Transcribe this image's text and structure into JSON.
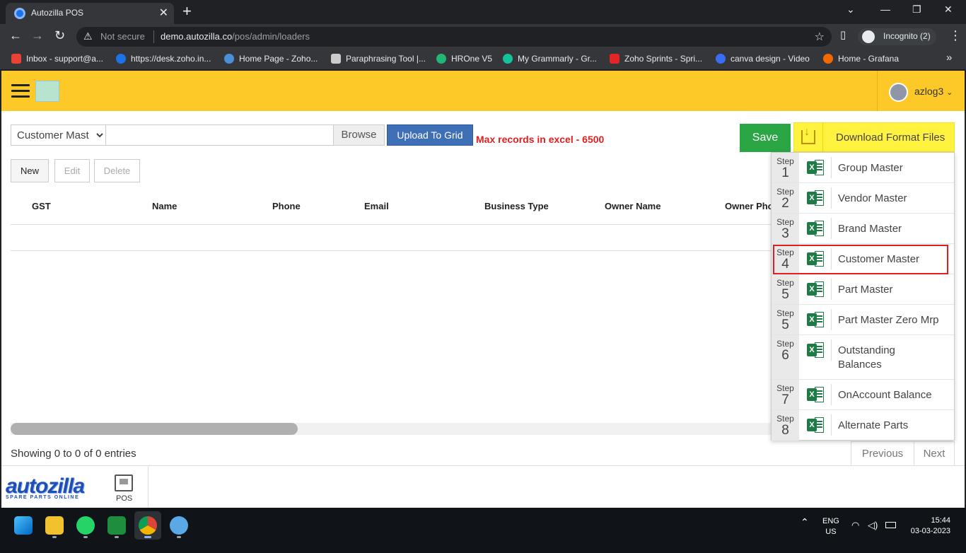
{
  "browser": {
    "tab_title": "Autozilla POS",
    "new_tab": "+",
    "not_secure": "Not secure",
    "url_host": "demo.autozilla.co",
    "url_path": "/pos/admin/loaders",
    "incognito": "Incognito (2)",
    "bookmarks": [
      {
        "label": "Inbox - support@a...",
        "color": "#ea4335"
      },
      {
        "label": "https://desk.zoho.in...",
        "color": "#1a73e8"
      },
      {
        "label": "Home Page - Zoho...",
        "color": "#4a90d9"
      },
      {
        "label": "Paraphrasing Tool |...",
        "color": "#cccccc"
      },
      {
        "label": "HROne V5",
        "color": "#22b573"
      },
      {
        "label": "My Grammarly - Gr...",
        "color": "#15c39a"
      },
      {
        "label": "Zoho Sprints - Spri...",
        "color": "#e42527"
      },
      {
        "label": "canva design - Video",
        "color": "#3b6cf5"
      },
      {
        "label": "Home - Grafana",
        "color": "#f46800"
      }
    ],
    "more": "»"
  },
  "header": {
    "username": "azlog3"
  },
  "toolbar": {
    "select_value": "Customer Mast",
    "browse": "Browse",
    "upload": "Upload To Grid",
    "max_records": "Max records in excel - 6500",
    "save": "Save",
    "download": "Download Format Files"
  },
  "actions": {
    "new": "New",
    "edit": "Edit",
    "delete": "Delete"
  },
  "table": {
    "columns": [
      "GST",
      "Name",
      "Phone",
      "Email",
      "Business Type",
      "Owner Name",
      "Owner Pho"
    ]
  },
  "footer": {
    "showing": "Showing 0 to 0 of 0 entries",
    "previous": "Previous",
    "next": "Next"
  },
  "bottom_nav": {
    "brand": "autozilla",
    "tagline": "SPARE PARTS ONLINE",
    "pos": "POS"
  },
  "dropdown": [
    {
      "step_label": "Step",
      "step": "1",
      "label": "Group Master"
    },
    {
      "step_label": "Step",
      "step": "2",
      "label": "Vendor Master"
    },
    {
      "step_label": "Step",
      "step": "3",
      "label": "Brand Master"
    },
    {
      "step_label": "Step",
      "step": "4",
      "label": "Customer Master",
      "highlighted": true
    },
    {
      "step_label": "Step",
      "step": "5",
      "label": "Part Master"
    },
    {
      "step_label": "Step",
      "step": "5",
      "label": "Part Master Zero Mrp"
    },
    {
      "step_label": "Step",
      "step": "6",
      "label": "Outstanding Balances"
    },
    {
      "step_label": "Step",
      "step": "7",
      "label": "OnAccount Balance"
    },
    {
      "step_label": "Step",
      "step": "8",
      "label": "Alternate Parts"
    }
  ],
  "taskbar": {
    "lang": "ENG",
    "region": "US",
    "time": "15:44",
    "date": "03-03-2023"
  }
}
